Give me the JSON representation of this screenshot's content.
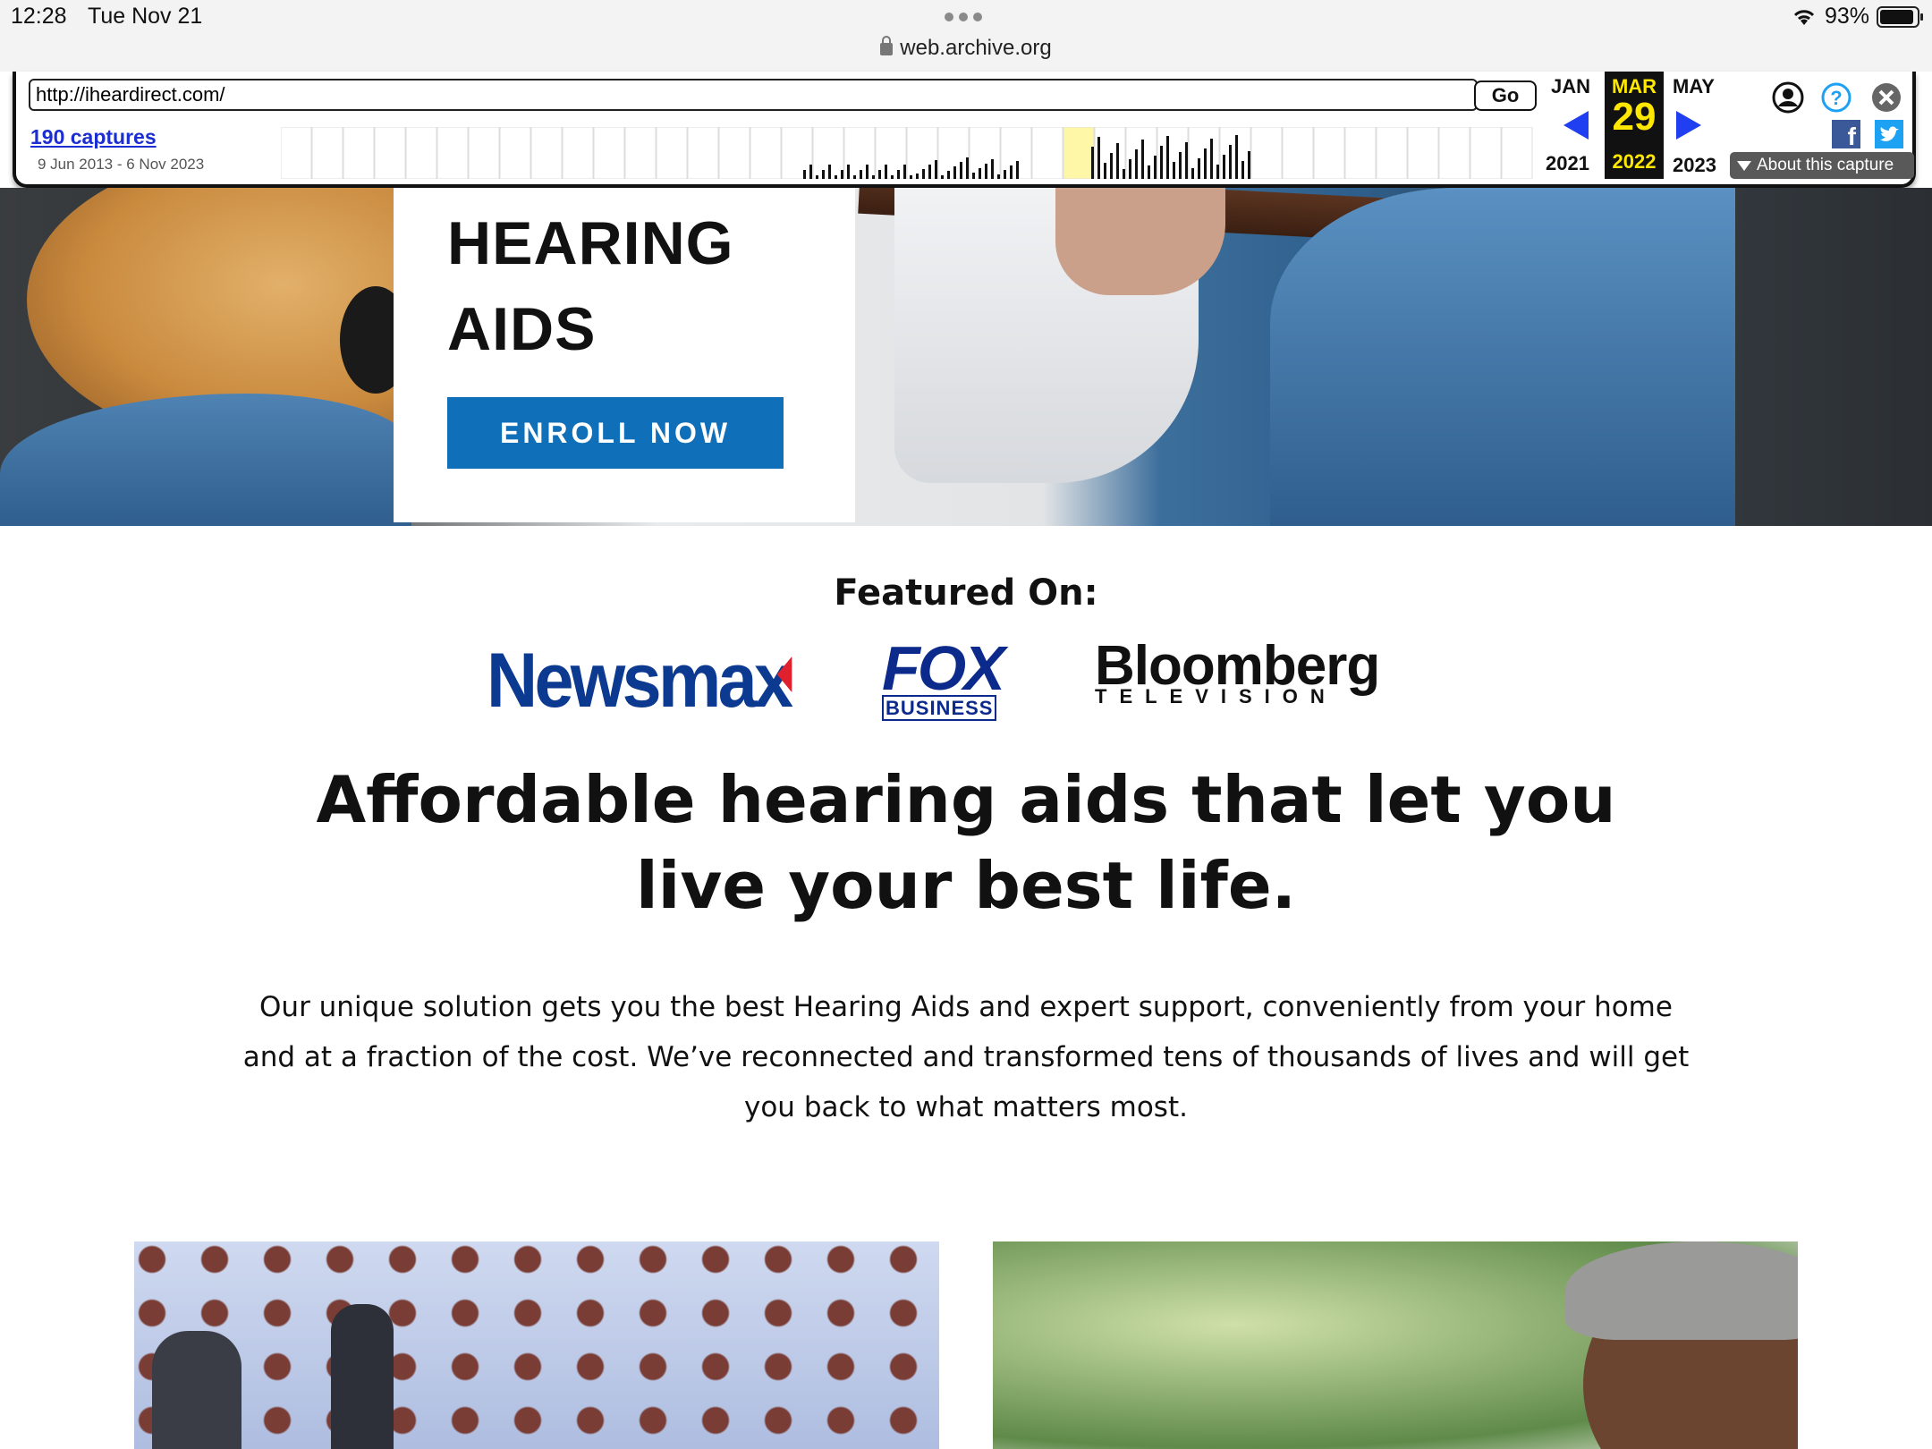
{
  "status_bar": {
    "time": "12:28",
    "date": "Tue Nov 21",
    "battery": "93%",
    "battery_level": 0.93,
    "url": "web.archive.org"
  },
  "wayback": {
    "url_value": "http://iheardirect.com/",
    "go_label": "Go",
    "captures_label": "190 captures",
    "date_range": "9 Jun 2013 - 6 Nov 2023",
    "prev": {
      "month": "JAN",
      "year": "2021"
    },
    "current": {
      "month": "MAR",
      "day": "29",
      "year": "2022"
    },
    "next": {
      "month": "MAY",
      "year": "2023"
    },
    "about_label": "About this capture",
    "accent_color": "#ffe800",
    "arrow_color": "#1f3ff0",
    "icons": [
      "account-icon",
      "help-icon",
      "close-icon",
      "facebook-icon",
      "twitter-icon"
    ]
  },
  "hero": {
    "title_line1": "HEARING",
    "title_line2": "AIDS",
    "cta_label": "ENROLL NOW",
    "cta_color": "#0f6fb8"
  },
  "featured": {
    "heading": "Featured On:",
    "logos": [
      {
        "name": "newsmax",
        "text": "Newsmax"
      },
      {
        "name": "fox-business",
        "text": "FOX",
        "subtext": "BUSINESS"
      },
      {
        "name": "bloomberg",
        "text": "Bloomberg",
        "subtext": "TELEVISION"
      }
    ]
  },
  "main": {
    "headline": "Affordable hearing aids that let you live your best life.",
    "body": "Our unique solution gets you the best Hearing Aids and expert support, conveniently from your home and at a fraction of the cost. We’ve reconnected and transformed tens of thousands of lives and will get you back to what matters most."
  }
}
